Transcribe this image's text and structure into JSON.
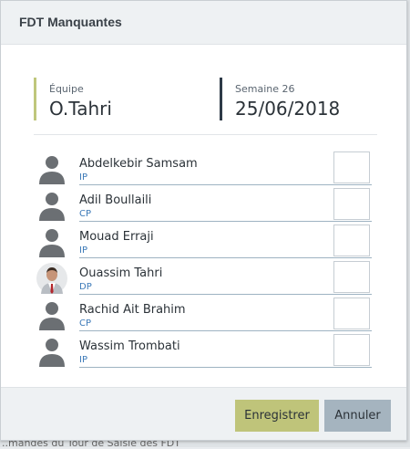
{
  "dialog": {
    "title": "FDT Manquantes"
  },
  "team": {
    "label": "Équipe",
    "value": "O.Tahri"
  },
  "week": {
    "label": "Semaine 26",
    "value": "25/06/2018"
  },
  "members": [
    {
      "name": "Abdelkebir Samsam",
      "role": "IP",
      "avatar": "person-placeholder-icon"
    },
    {
      "name": "Adil Boullaili",
      "role": "CP",
      "avatar": "person-placeholder-icon"
    },
    {
      "name": "Mouad Erraji",
      "role": "IP",
      "avatar": "person-placeholder-icon"
    },
    {
      "name": "Ouassim Tahri",
      "role": "DP",
      "avatar": "profile-photo"
    },
    {
      "name": "Rachid Ait Brahim",
      "role": "CP",
      "avatar": "person-placeholder-icon"
    },
    {
      "name": "Wassim Trombati",
      "role": "IP",
      "avatar": "person-placeholder-icon"
    }
  ],
  "buttons": {
    "save": "Enregistrer",
    "cancel": "Annuler"
  },
  "background": {
    "partial_text": "..mandes du Tour de Saisie des FDT"
  },
  "colors": {
    "save_button": "#bfc47a",
    "cancel_button": "#a5b4bf",
    "team_accent": "#bfc77c",
    "week_accent": "#2e3a47",
    "role_text": "#3d7ab8"
  }
}
